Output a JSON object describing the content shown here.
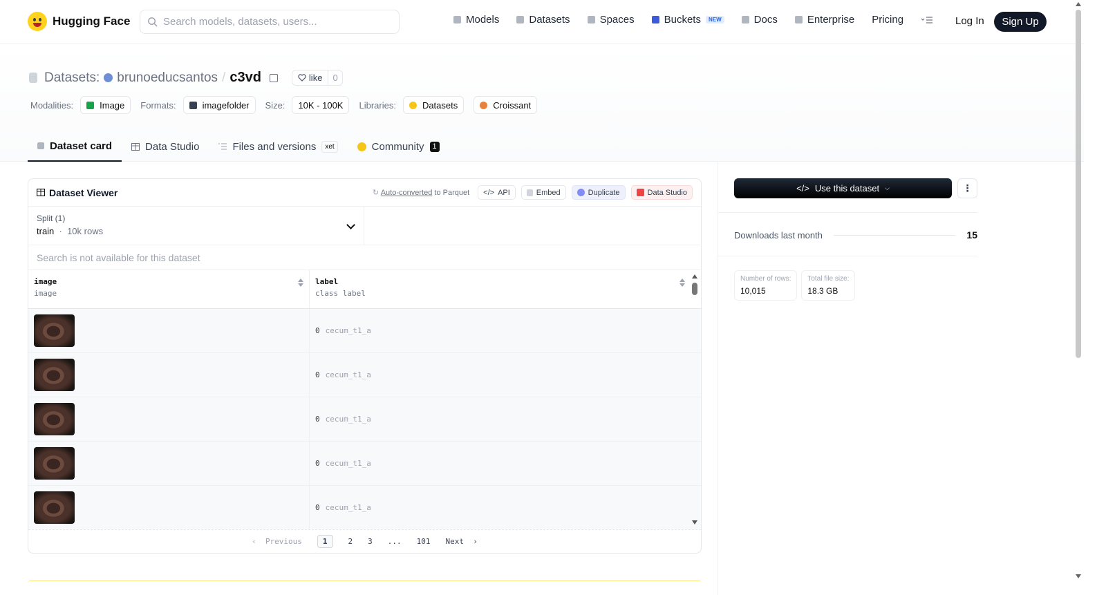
{
  "nav": {
    "logo_text": "Hugging Face",
    "search_placeholder": "Search models, datasets, users...",
    "links": [
      {
        "label": "Models",
        "icon": "cube-icon"
      },
      {
        "label": "Datasets",
        "icon": "database-icon"
      },
      {
        "label": "Spaces",
        "icon": "grid-icon"
      },
      {
        "label": "Buckets",
        "icon": "bucket-icon",
        "badge": "NEW"
      },
      {
        "label": "Docs",
        "icon": "book-icon"
      },
      {
        "label": "Enterprise",
        "icon": "enterprise-icon"
      },
      {
        "label": "Pricing"
      }
    ],
    "login": "Log In",
    "signup": "Sign Up"
  },
  "header": {
    "section": "Datasets:",
    "owner": "brunoeducsantos",
    "sep": "/",
    "repo": "c3vd",
    "like_label": "like",
    "like_count": "0",
    "meta": [
      {
        "label": "Modalities:",
        "tags": [
          {
            "text": "Image",
            "color": "#16a34a"
          }
        ]
      },
      {
        "label": "Formats:",
        "tags": [
          {
            "text": "imagefolder",
            "color": "#374151"
          }
        ]
      },
      {
        "label": "Size:",
        "tags": [
          {
            "text": "10K - 100K"
          }
        ]
      },
      {
        "label": "Libraries:",
        "tags": [
          {
            "text": "Datasets",
            "color": "#f5c518"
          },
          {
            "text": "Croissant",
            "color": "#e8823a"
          }
        ]
      }
    ],
    "tabs": [
      {
        "label": "Dataset card",
        "active": true
      },
      {
        "label": "Data Studio"
      },
      {
        "label": "Files and versions",
        "badge": "xet"
      },
      {
        "label": "Community",
        "count": "1"
      }
    ]
  },
  "viewer": {
    "title": "Dataset Viewer",
    "auto_converted": "Auto-converted",
    "to_parquet": " to Parquet",
    "buttons": [
      "API",
      "Embed",
      "Duplicate",
      "Data Studio"
    ],
    "split_label": "Split (1)",
    "split_name": "train",
    "split_rows": "10k rows",
    "search_note": "Search is not available for this dataset",
    "columns": [
      {
        "name": "image",
        "type": "image"
      },
      {
        "name": "label",
        "type": "class label"
      }
    ],
    "rows": [
      {
        "num": "0",
        "label": "cecum_t1_a"
      },
      {
        "num": "0",
        "label": "cecum_t1_a"
      },
      {
        "num": "0",
        "label": "cecum_t1_a"
      },
      {
        "num": "0",
        "label": "cecum_t1_a"
      },
      {
        "num": "0",
        "label": "cecum_t1_a"
      }
    ],
    "pager": {
      "prev": "Previous",
      "pages": [
        "1",
        "2",
        "3",
        "...",
        "101"
      ],
      "current": "1",
      "next": "Next"
    }
  },
  "sidebar": {
    "use_button": "Use this dataset",
    "downloads_label": "Downloads last month",
    "downloads_value": "15",
    "stats": [
      {
        "key": "Number of rows:",
        "value": "10,015"
      },
      {
        "key": "Total file size:",
        "value": "18.3 GB"
      }
    ]
  },
  "colors": {
    "accent_dark": "#111827",
    "brand_yellow": "#ffd21e"
  }
}
